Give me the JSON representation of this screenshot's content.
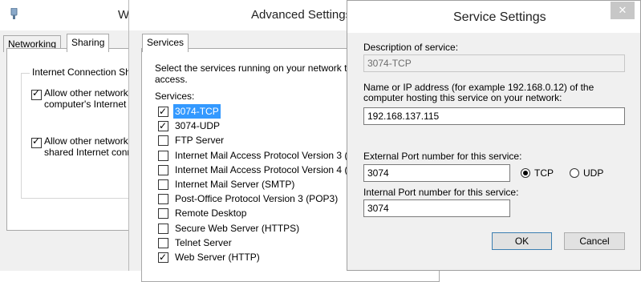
{
  "win1": {
    "title": "W",
    "tabs": [
      "Networking",
      "Sharing"
    ],
    "group_label": "Internet Connection Sha",
    "options": [
      {
        "line1": "Allow other network u",
        "line2": "computer's Internet c",
        "checked": true
      },
      {
        "line1": "Allow other network u",
        "line2": "shared Internet conn",
        "checked": true
      }
    ]
  },
  "win2": {
    "title": "Advanced Settings",
    "tab": "Services",
    "instruction_line1": "Select the services running on your network tha",
    "instruction_line2": "access.",
    "services_label": "Services:",
    "services": [
      {
        "label": "3074-TCP",
        "checked": true,
        "selected": true
      },
      {
        "label": "3074-UDP",
        "checked": true,
        "selected": false
      },
      {
        "label": "FTP Server",
        "checked": false,
        "selected": false
      },
      {
        "label": "Internet Mail Access Protocol Version 3 (IM",
        "checked": false,
        "selected": false
      },
      {
        "label": "Internet Mail Access Protocol Version 4 (IM",
        "checked": false,
        "selected": false
      },
      {
        "label": "Internet Mail Server (SMTP)",
        "checked": false,
        "selected": false
      },
      {
        "label": "Post-Office Protocol Version 3 (POP3)",
        "checked": false,
        "selected": false
      },
      {
        "label": "Remote Desktop",
        "checked": false,
        "selected": false
      },
      {
        "label": "Secure Web Server (HTTPS)",
        "checked": false,
        "selected": false
      },
      {
        "label": "Telnet Server",
        "checked": false,
        "selected": false
      },
      {
        "label": "Web Server (HTTP)",
        "checked": true,
        "selected": false
      }
    ]
  },
  "win3": {
    "title": "Service Settings",
    "description_label": "Description of service:",
    "description_value": "3074-TCP",
    "host_label_line1": "Name or IP address (for example 192.168.0.12) of the",
    "host_label_line2": "computer hosting this service on your network:",
    "host_value": "192.168.137.115",
    "external_port_label": "External Port number for this service:",
    "external_port_value": "3074",
    "protocol_tcp_label": "TCP",
    "protocol_udp_label": "UDP",
    "protocol_selected": "TCP",
    "internal_port_label": "Internal Port number for this service:",
    "internal_port_value": "3074",
    "ok_label": "OK",
    "cancel_label": "Cancel",
    "close_glyph": "✕"
  },
  "colors": {
    "selection": "#3399ff",
    "dialog_bg": "#f0f0f0",
    "close_button": "#c7c7c7"
  }
}
